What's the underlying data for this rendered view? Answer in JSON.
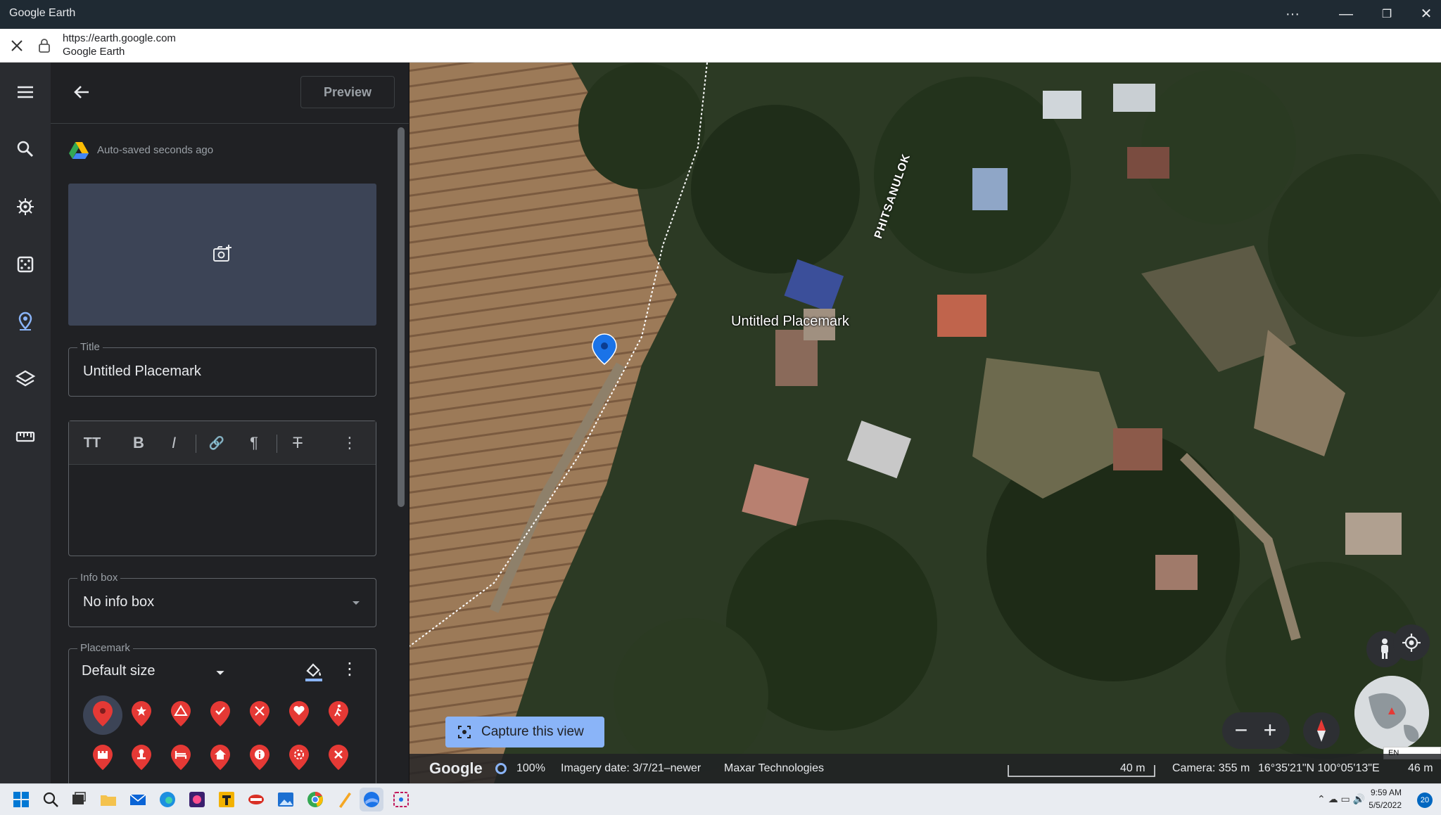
{
  "window": {
    "title": "Google Earth",
    "controls": [
      "···",
      "—",
      "❐",
      "✕"
    ]
  },
  "address": {
    "url": "https://earth.google.com",
    "site": "Google Earth"
  },
  "panel": {
    "preview_label": "Preview",
    "autosave_text": "Auto-saved seconds ago",
    "title_legend": "Title",
    "title_value": "Untitled Placemark",
    "infobox_legend": "Info box",
    "infobox_value": "No info box",
    "placemark_legend": "Placemark",
    "size_label": "Default size",
    "toolbar": {
      "text_size": "TT",
      "bold": "B",
      "italic": "I",
      "link": "🔗",
      "paragraph": "¶",
      "clear_format": "T",
      "more": "⋮"
    }
  },
  "map": {
    "placemark_label": "Untitled Placemark",
    "road_label": "PHITSANULOK",
    "capture_label": "Capture this view",
    "view_mode": "3D",
    "lang_badge": "EN"
  },
  "status": {
    "logo": "Google",
    "progress": "100%",
    "imagery_date": "Imagery date: 3/7/21–newer",
    "provider": "Maxar Technologies",
    "scale": "40 m",
    "camera": "Camera: 355 m",
    "coordinates": "16°35'21\"N 100°05'13\"E",
    "elevation": "46 m"
  },
  "taskbar": {
    "time": "9:59 AM",
    "date": "5/5/2022",
    "notifications": "20"
  },
  "colors": {
    "accent": "#8ab4f8",
    "pin_red": "#e53935",
    "placemark_blue": "#1a73e8"
  }
}
